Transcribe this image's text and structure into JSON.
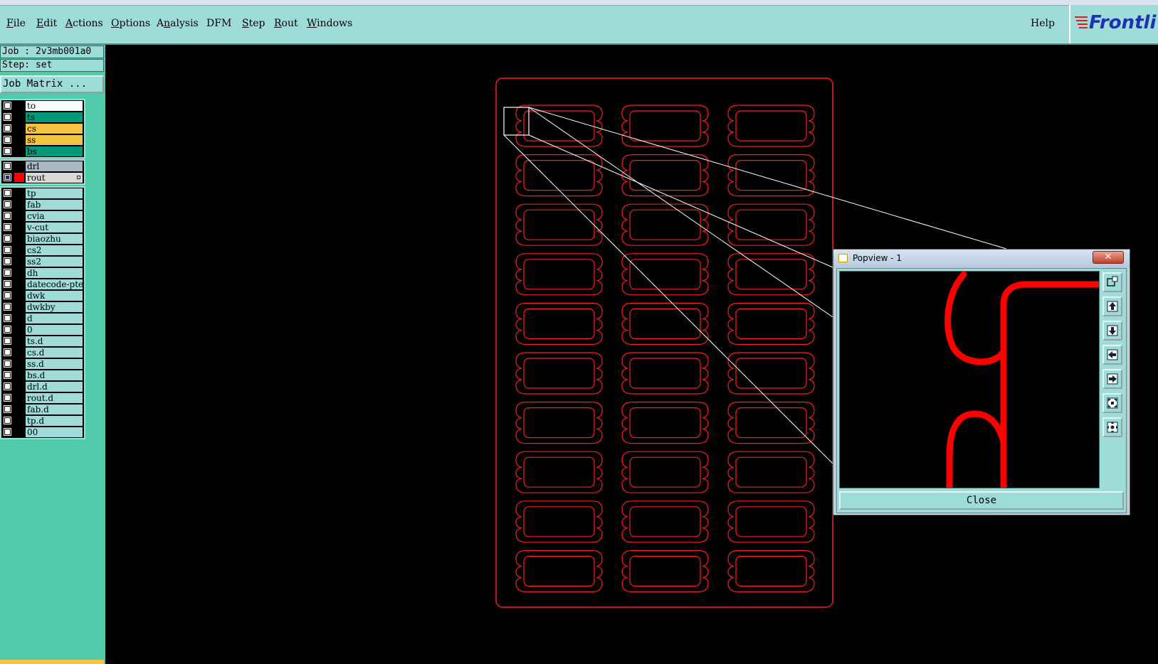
{
  "menubar": {
    "items": [
      {
        "label": "File",
        "mnemonic": "F"
      },
      {
        "label": "Edit",
        "mnemonic": "E"
      },
      {
        "label": "Actions",
        "mnemonic": "A"
      },
      {
        "label": "Options",
        "mnemonic": "O"
      },
      {
        "label": "Analysis",
        "mnemonic": "n"
      },
      {
        "label": "DFM",
        "mnemonic": ""
      },
      {
        "label": "Step",
        "mnemonic": "S"
      },
      {
        "label": "Rout",
        "mnemonic": "R"
      },
      {
        "label": "Windows",
        "mnemonic": "W"
      }
    ],
    "help_label": "Help",
    "logo_text": "Frontli"
  },
  "job_info": {
    "job": "Job : 2v3mb001a0",
    "step": "Step: set",
    "job_matrix_label": "Job Matrix ..."
  },
  "layer_groups": [
    [
      {
        "name": "to",
        "color": "#ffffff",
        "checked": false
      },
      {
        "name": "ts",
        "color": "#00997a",
        "checked": false
      },
      {
        "name": "cs",
        "color": "#f5c242",
        "checked": false
      },
      {
        "name": "ss",
        "color": "#f5c242",
        "checked": false
      },
      {
        "name": "bs",
        "color": "#00997a",
        "checked": false
      }
    ],
    [
      {
        "name": "drl",
        "color": "#a6b8c4",
        "checked": false
      },
      {
        "name": "rout",
        "color": "#d9d9d9",
        "checked": true,
        "active_swatch": "#ff0000",
        "marked": true
      }
    ],
    [
      {
        "name": "tp",
        "color": "#9ddcd9",
        "checked": false
      },
      {
        "name": "fab",
        "color": "#9ddcd9",
        "checked": false
      },
      {
        "name": "cvia",
        "color": "#9ddcd9",
        "checked": false
      },
      {
        "name": "v-cut",
        "color": "#9ddcd9",
        "checked": false
      },
      {
        "name": "biaozhu",
        "color": "#9ddcd9",
        "checked": false
      },
      {
        "name": "cs2",
        "color": "#9ddcd9",
        "checked": false
      },
      {
        "name": "ss2",
        "color": "#9ddcd9",
        "checked": false
      },
      {
        "name": "dh",
        "color": "#9ddcd9",
        "checked": false
      },
      {
        "name": "datecode-pte",
        "color": "#9ddcd9",
        "checked": false
      },
      {
        "name": "dwk",
        "color": "#9ddcd9",
        "checked": false
      },
      {
        "name": "dwkby",
        "color": "#9ddcd9",
        "checked": false
      },
      {
        "name": "d",
        "color": "#9ddcd9",
        "checked": false
      },
      {
        "name": "0",
        "color": "#9ddcd9",
        "checked": false
      },
      {
        "name": "ts.d",
        "color": "#9ddcd9",
        "checked": false
      },
      {
        "name": "cs.d",
        "color": "#9ddcd9",
        "checked": false
      },
      {
        "name": "ss.d",
        "color": "#9ddcd9",
        "checked": false
      },
      {
        "name": "bs.d",
        "color": "#9ddcd9",
        "checked": false
      },
      {
        "name": "drl.d",
        "color": "#9ddcd9",
        "checked": false
      },
      {
        "name": "rout.d",
        "color": "#9ddcd9",
        "checked": false
      },
      {
        "name": "fab.d",
        "color": "#9ddcd9",
        "checked": false
      },
      {
        "name": "tp.d",
        "color": "#9ddcd9",
        "checked": false
      },
      {
        "name": "00",
        "color": "#9ddcd9",
        "checked": false
      }
    ]
  ],
  "canvas": {
    "background": "#000000",
    "outline_color": "#ff1a1a",
    "zoom_frame_color": "#ffffff",
    "panel_rows": 10,
    "panel_cols": 3
  },
  "popview": {
    "title": "Popview - 1",
    "close_label": "Close",
    "tools": [
      "zoom-window-icon",
      "pan-up-icon",
      "pan-down-icon",
      "pan-left-icon",
      "pan-right-icon",
      "zoom-fit-icon",
      "zoom-center-icon"
    ]
  },
  "colors": {
    "menu_bg": "#9ddcd9",
    "panel_bg": "#50cbaa",
    "rout_red": "#ff0000"
  }
}
